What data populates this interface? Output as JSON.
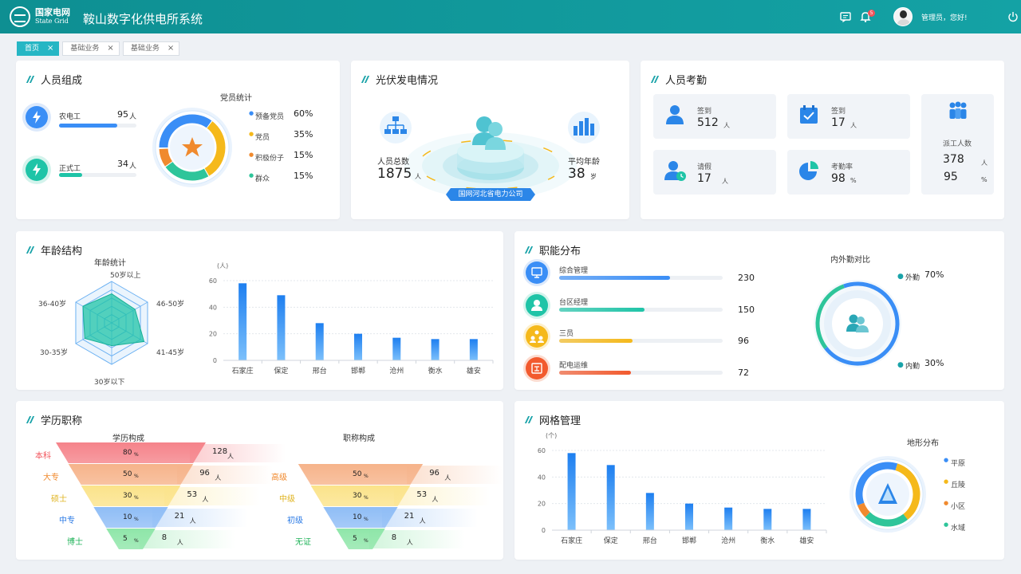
{
  "header": {
    "logo_cn": "国家电网",
    "logo_en": "State Grid",
    "title": "鞍山数字化供电所系统",
    "badge": "5",
    "user": "管理员，您好!"
  },
  "tabs": [
    {
      "label": "首页"
    },
    {
      "label": "基础业务"
    },
    {
      "label": "基础业务"
    }
  ],
  "staff": {
    "title": "人员组成",
    "rows": [
      {
        "label": "农电工",
        "value": "95",
        "unit": "人",
        "fill": 0.75,
        "color": "#3a8ef6"
      },
      {
        "label": "正式工",
        "value": "34",
        "unit": "人",
        "fill": 0.3,
        "color": "#1fc4a7"
      }
    ],
    "party": {
      "title": "党员统计",
      "items": [
        {
          "label": "预备党员",
          "pct": "60%",
          "color": "#3a8ef6"
        },
        {
          "label": "党员",
          "pct": "35%",
          "color": "#f5b91b"
        },
        {
          "label": "积极份子",
          "pct": "15%",
          "color": "#f08a2e"
        },
        {
          "label": "群众",
          "pct": "15%",
          "color": "#2ec59a"
        }
      ]
    }
  },
  "pv": {
    "title": "光伏发电情况",
    "total_label": "人员总数",
    "total": "1875",
    "total_unit": "人",
    "age_label": "平均年龄",
    "age": "38",
    "age_unit": "岁",
    "company": "国网河北省电力公司"
  },
  "attendance": {
    "title": "人员考勤",
    "items": [
      {
        "label": "签到",
        "value": "512",
        "unit": "人"
      },
      {
        "label": "签到",
        "value": "17",
        "unit": "人"
      },
      {
        "label": "请假",
        "value": "17",
        "unit": "人"
      },
      {
        "label": "考勤率",
        "value": "98",
        "unit": "%"
      }
    ],
    "dispatch": {
      "label": "派工人数",
      "v1": "378",
      "u1": "人",
      "v2": "95",
      "u2": "%"
    }
  },
  "age": {
    "title": "年龄结构",
    "radar_title": "年龄统计",
    "radar_labels": [
      "50岁以上",
      "46-50岁",
      "41-45岁",
      "30岁以下",
      "30-35岁",
      "36-40岁"
    ],
    "radar_values": [
      0.7,
      0.65,
      0.9,
      0.55,
      0.75,
      0.8
    ]
  },
  "jobs": {
    "title": "职能分布",
    "rows": [
      {
        "label": "综合管理",
        "value": "230",
        "fill": 0.68,
        "color": "#3a8ef6"
      },
      {
        "label": "台区经理",
        "value": "150",
        "fill": 0.52,
        "color": "#1fc4a7"
      },
      {
        "label": "三员",
        "value": "96",
        "fill": 0.45,
        "color": "#f5b91b"
      },
      {
        "label": "配电运维",
        "value": "72",
        "fill": 0.44,
        "color": "#f25a2e"
      }
    ],
    "ring_title": "内外勤对比",
    "outer_label": "外勤",
    "outer_pct": "70%",
    "inner_label": "内勤",
    "inner_pct": "30%"
  },
  "edu": {
    "title": "学历职称",
    "f1_title": "学历构成",
    "f1": [
      {
        "label": "本科",
        "pct": "80",
        "count": "128",
        "color": "#f5838a",
        "tcolor": "#f2545b"
      },
      {
        "label": "大专",
        "pct": "50",
        "count": "96",
        "color": "#f6b38a",
        "tcolor": "#f08a2e"
      },
      {
        "label": "硕士",
        "pct": "30",
        "count": "53",
        "color": "#fbe38a",
        "tcolor": "#e0b421"
      },
      {
        "label": "中专",
        "pct": "10",
        "count": "21",
        "color": "#8fbdf6",
        "tcolor": "#2c7be5"
      },
      {
        "label": "博士",
        "pct": "5",
        "count": "8",
        "color": "#8fe6a9",
        "tcolor": "#21b35a"
      }
    ],
    "f2_title": "职称构成",
    "f2": [
      {
        "label": "高级",
        "pct": "50",
        "count": "96",
        "color": "#f6b38a",
        "tcolor": "#f08a2e"
      },
      {
        "label": "中级",
        "pct": "30",
        "count": "53",
        "color": "#fbe38a",
        "tcolor": "#e0b421"
      },
      {
        "label": "初级",
        "pct": "10",
        "count": "21",
        "color": "#8fbdf6",
        "tcolor": "#2c7be5"
      },
      {
        "label": "无证",
        "pct": "5",
        "count": "8",
        "color": "#8fe6a9",
        "tcolor": "#21b35a"
      }
    ],
    "pct_unit": "%",
    "count_unit": "人"
  },
  "grid": {
    "title": "网格管理",
    "terrain_title": "地形分布",
    "terrain": [
      {
        "label": "平原",
        "color": "#3a8ef6"
      },
      {
        "label": "丘陵",
        "color": "#f5b91b"
      },
      {
        "label": "小区",
        "color": "#f08a2e"
      },
      {
        "label": "水域",
        "color": "#2ec59a"
      }
    ]
  },
  "chart_data": [
    {
      "type": "bar",
      "ylabel": "(人)",
      "ylim": [
        0,
        60
      ],
      "yticks": [
        0,
        20,
        40,
        60
      ],
      "categories": [
        "石家庄",
        "保定",
        "邢台",
        "邯郸",
        "沧州",
        "衡水",
        "雄安"
      ],
      "values": [
        58,
        49,
        28,
        20,
        17,
        16,
        16
      ]
    },
    {
      "type": "bar",
      "ylabel": "(个)",
      "ylim": [
        0,
        60
      ],
      "yticks": [
        0,
        20,
        40,
        60
      ],
      "categories": [
        "石家庄",
        "保定",
        "邢台",
        "邯郸",
        "沧州",
        "衡水",
        "雄安"
      ],
      "values": [
        58,
        49,
        28,
        20,
        17,
        16,
        16
      ]
    }
  ]
}
